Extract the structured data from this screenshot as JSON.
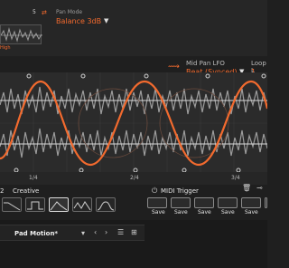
{
  "top": {
    "number": "5",
    "pan_mode_label": "Pan Mode",
    "pan_mode_value": "Balance 3dB",
    "high_label": "High"
  },
  "lfo": {
    "mid_pan_lfo_label": "Mid Pan LFO",
    "mid_pan_lfo_value": "Beat (Synced)",
    "loop_label": "Loop L",
    "loop_value": "1 Bar"
  },
  "ruler": {
    "ticks": [
      "1/4",
      "2/4",
      "3/4"
    ]
  },
  "shape_section": {
    "number": "2",
    "label": "Creative",
    "shapes": [
      "flat",
      "ramp-up",
      "square",
      "triangle",
      "zigzag",
      "bump"
    ]
  },
  "midi": {
    "label": "MIDI Trigger",
    "slot_labels": [
      "Save",
      "Save",
      "Save",
      "Save",
      "Save",
      "Save"
    ]
  },
  "preset": {
    "name": "Pad Motion*"
  },
  "icons": {
    "power": "power-icon",
    "trash": "trash-icon",
    "link": "link-icon",
    "dropdown": "chevron-down-icon",
    "prev": "chevron-left-icon",
    "next": "chevron-right-icon",
    "menu": "menu-icon",
    "grid": "grid-icon"
  },
  "colors": {
    "accent": "#f26a2e",
    "background": "#1f1f1f",
    "editor_bg": "#2b2b2b",
    "waveform": "#9c9c9c"
  }
}
